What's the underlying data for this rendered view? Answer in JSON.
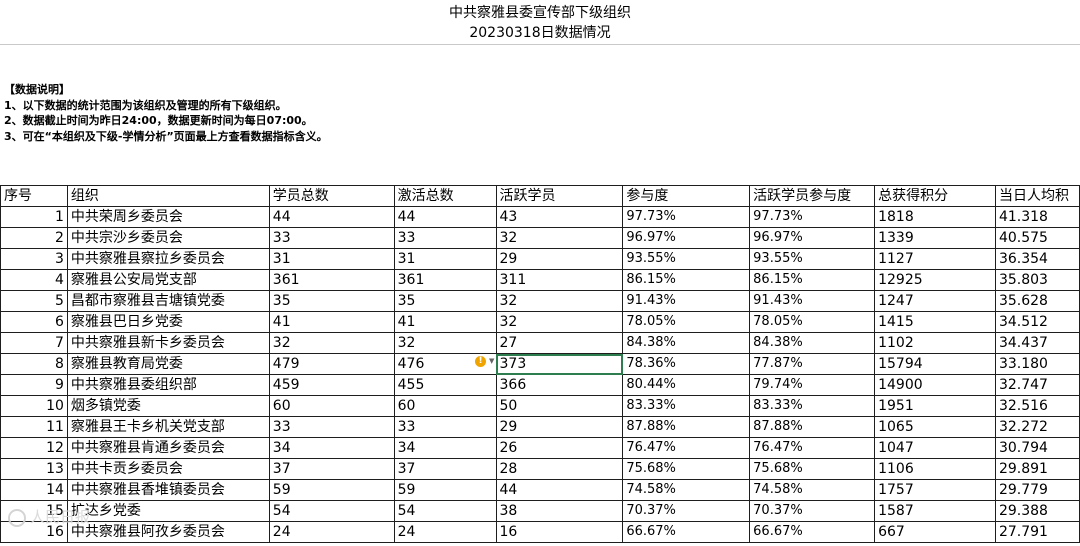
{
  "title": "中共察雅县委宣传部下级组织",
  "subtitle": "20230318日数据情况",
  "notes": {
    "heading": "【数据说明】",
    "lines": [
      "1、以下数据的统计范围为该组织及管理的所有下级组织。",
      "2、数据截止时间为昨日24:00，数据更新时间为每日07:00。",
      "3、可在“本组织及下级-学情分析”页面最上方查看数据指标含义。"
    ]
  },
  "table": {
    "headers": [
      "序号",
      "组织",
      "学员总数",
      "激活总数",
      "活跃学员",
      "参与度",
      "活跃学员参与度",
      "总获得积分",
      "当日人均积"
    ],
    "rows": [
      [
        "1",
        "中共荣周乡委员会",
        "44",
        "44",
        "43",
        "97.73%",
        "97.73%",
        "1818",
        "41.318"
      ],
      [
        "2",
        "中共宗沙乡委员会",
        "33",
        "33",
        "32",
        "96.97%",
        "96.97%",
        "1339",
        "40.575"
      ],
      [
        "3",
        "中共察雅县察拉乡委员会",
        "31",
        "31",
        "29",
        "93.55%",
        "93.55%",
        "1127",
        "36.354"
      ],
      [
        "4",
        "察雅县公安局党支部",
        "361",
        "361",
        "311",
        "86.15%",
        "86.15%",
        "12925",
        "35.803"
      ],
      [
        "5",
        "昌都市察雅县吉塘镇党委",
        "35",
        "35",
        "32",
        "91.43%",
        "91.43%",
        "1247",
        "35.628"
      ],
      [
        "6",
        "察雅县巴日乡党委",
        "41",
        "41",
        "32",
        "78.05%",
        "78.05%",
        "1415",
        "34.512"
      ],
      [
        "7",
        "中共察雅县新卡乡委员会",
        "32",
        "32",
        "27",
        "84.38%",
        "84.38%",
        "1102",
        "34.437"
      ],
      [
        "8",
        "察雅县教育局党委",
        "479",
        "476",
        "373",
        "78.36%",
        "77.87%",
        "15794",
        "33.180"
      ],
      [
        "9",
        "中共察雅县委组织部",
        "459",
        "455",
        "366",
        "80.44%",
        "79.74%",
        "14900",
        "32.747"
      ],
      [
        "10",
        "烟多镇党委",
        "60",
        "60",
        "50",
        "83.33%",
        "83.33%",
        "1951",
        "32.516"
      ],
      [
        "11",
        "察雅县王卡乡机关党支部",
        "33",
        "33",
        "29",
        "87.88%",
        "87.88%",
        "1065",
        "32.272"
      ],
      [
        "12",
        "中共察雅县肯通乡委员会",
        "34",
        "34",
        "26",
        "76.47%",
        "76.47%",
        "1047",
        "30.794"
      ],
      [
        "13",
        "中共卡贡乡委员会",
        "37",
        "37",
        "28",
        "75.68%",
        "75.68%",
        "1106",
        "29.891"
      ],
      [
        "14",
        "中共察雅县香堆镇委员会",
        "59",
        "59",
        "44",
        "74.58%",
        "74.58%",
        "1757",
        "29.779"
      ],
      [
        "15",
        "扩达乡党委",
        "54",
        "54",
        "38",
        "70.37%",
        "70.37%",
        "1587",
        "29.388"
      ],
      [
        "16",
        "中共察雅县阿孜乡委员会",
        "24",
        "24",
        "16",
        "66.67%",
        "66.67%",
        "667",
        "27.791"
      ]
    ]
  },
  "warning_icon": "exclamation-icon",
  "watermark": "人民日报"
}
